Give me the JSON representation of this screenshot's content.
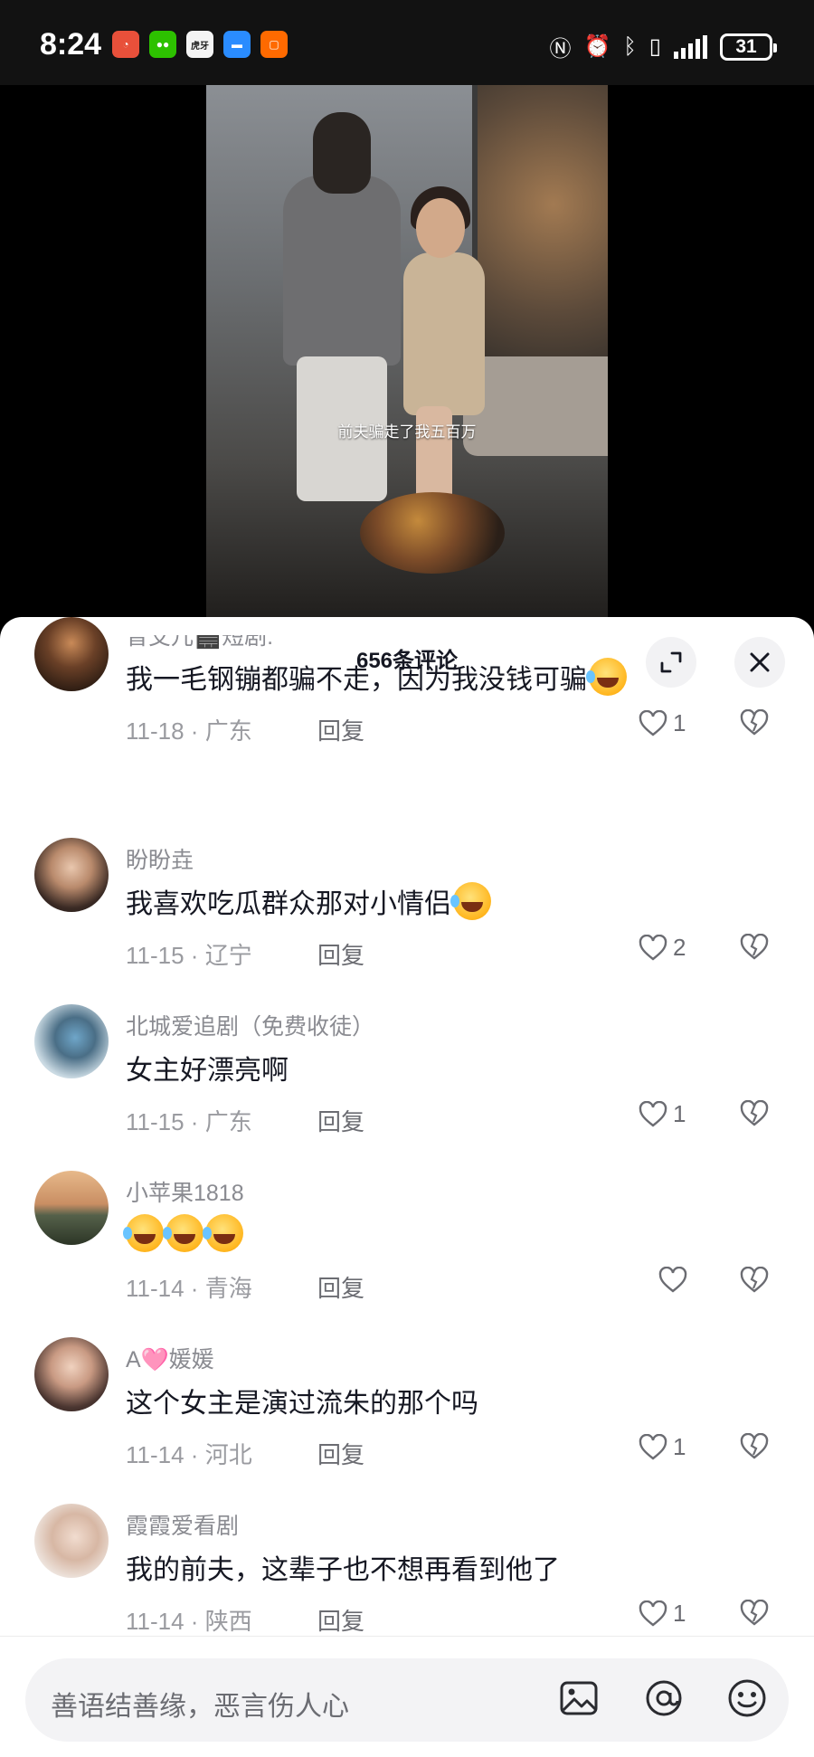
{
  "status_bar": {
    "time": "8:24",
    "app_icons": [
      "weibo-icon",
      "wechat-icon",
      "huya-icon",
      "message-icon",
      "taobao-icon"
    ],
    "app_icon_colors": [
      "#e8503a",
      "#2dc100",
      "#f4f4f4",
      "#2a8cff",
      "#ff6a00"
    ],
    "huya_label": "虎牙",
    "battery": "31"
  },
  "video": {
    "subtitle": "前夫骗走了我五百万"
  },
  "comments_panel": {
    "title": "656条评论",
    "expand_icon": "expand-icon",
    "close_icon": "close-icon"
  },
  "comments": [
    {
      "user": "曾艾儿🎬短剧.",
      "text": "我一毛钢镚都骗不走，因为我没钱可骗",
      "emojis": 1,
      "date": "11-18",
      "location": "广东",
      "reply": "回复",
      "likes": "1"
    },
    {
      "user": "盼盼垚",
      "text": "我喜欢吃瓜群众那对小情侣",
      "emojis": 1,
      "date": "11-15",
      "location": "辽宁",
      "reply": "回复",
      "likes": "2"
    },
    {
      "user": "北城爱追剧（免费收徒）",
      "text": "女主好漂亮啊",
      "emojis": 0,
      "date": "11-15",
      "location": "广东",
      "reply": "回复",
      "likes": "1"
    },
    {
      "user": "小苹果1818",
      "text": "",
      "emojis": 3,
      "date": "11-14",
      "location": "青海",
      "reply": "回复",
      "likes": ""
    },
    {
      "user": "A🩷媛媛",
      "text": "这个女主是演过流朱的那个吗",
      "emojis": 0,
      "date": "11-14",
      "location": "河北",
      "reply": "回复",
      "likes": "1"
    },
    {
      "user": "霞霞爱看剧",
      "text": "我的前夫，这辈子也不想再看到他了",
      "emojis": 0,
      "date": "11-14",
      "location": "陕西",
      "reply": "回复",
      "likes": "1"
    }
  ],
  "input": {
    "placeholder": "善语结善缘，恶言伤人心",
    "icons": [
      "image-icon",
      "mention-icon",
      "emoji-icon"
    ]
  }
}
